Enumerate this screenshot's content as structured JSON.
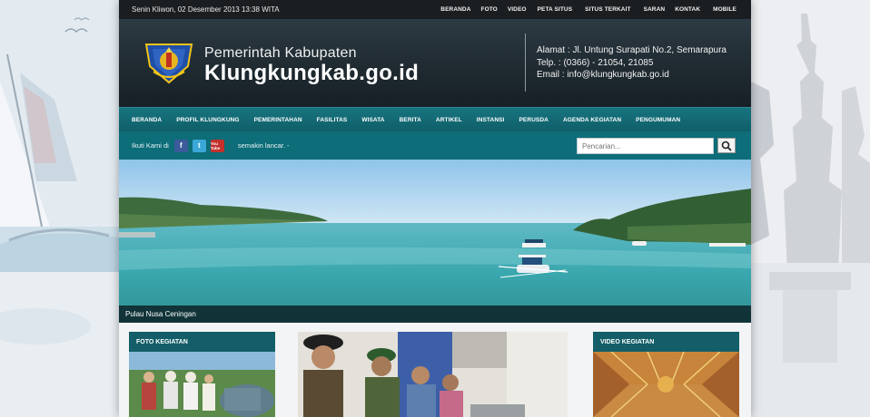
{
  "topbar": {
    "date": "Senin Kliwon,  02 Desember 2013 13:38 WITA",
    "nav": [
      "BERANDA",
      "FOTO",
      "VIDEO",
      "PETA SITUS",
      "SITUS TERKAIT",
      "SARAN",
      "KONTAK",
      "MOBILE"
    ]
  },
  "header": {
    "title_small": "Pemerintah Kabupaten",
    "title_big": "Klungkungkab.go.id",
    "address": "Alamat : Jl. Untung Surapati No.2, Semarapura",
    "phone": "Telp. : (0366) - 21054, 21085",
    "email": "Email : info@klungkungkab.go.id"
  },
  "mainnav": [
    "BERANDA",
    "PROFIL KLUNGKUNG",
    "PEMERINTAHAN",
    "FASILITAS",
    "WISATA",
    "BERITA",
    "ARTIKEL",
    "INSTANSI",
    "PERUSDA",
    "AGENDA KEGIATAN",
    "PENGUMUMAN"
  ],
  "social": {
    "follow_label": "Ikuti Kami di",
    "facebook_glyph": "f",
    "twitter_glyph": "t",
    "youtube_glyph": "You Tube",
    "ticker": "semakin lancar. -",
    "search_placeholder": "Pencarian..."
  },
  "slider": {
    "caption": "Pulau Nusa Ceningan"
  },
  "panels": {
    "foto_title": "FOTO KEGIATAN",
    "video_title": "VIDEO KEGIATAN"
  },
  "colors": {
    "topbar": "#1b1e21",
    "header": "#1f2a31",
    "mainnav": "#17747f",
    "socialbar": "#0d6d78",
    "panel_head": "#135e68"
  },
  "icons": [
    "emblem-icon",
    "facebook-icon",
    "twitter-icon",
    "youtube-icon",
    "search-icon"
  ]
}
